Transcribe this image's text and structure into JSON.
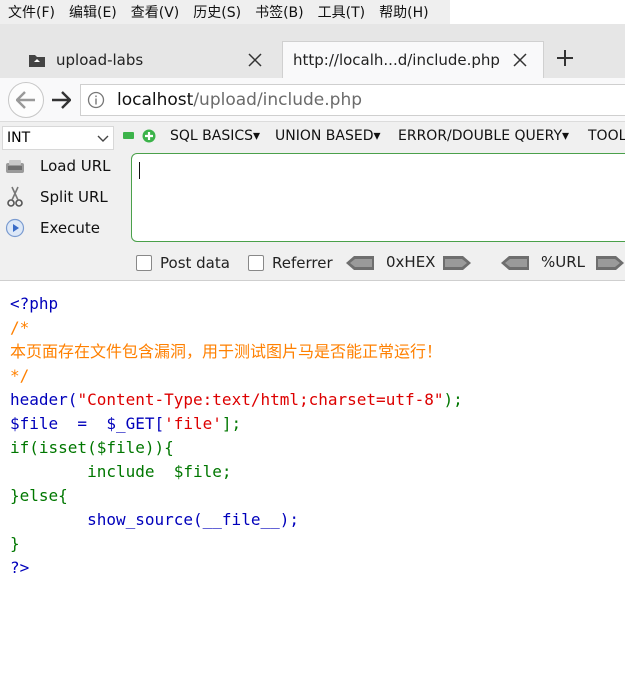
{
  "menubar": {
    "items": [
      {
        "label": "文件(F)"
      },
      {
        "label": "编辑(E)"
      },
      {
        "label": "查看(V)"
      },
      {
        "label": "历史(S)"
      },
      {
        "label": "书签(B)"
      },
      {
        "label": "工具(T)"
      },
      {
        "label": "帮助(H)"
      }
    ]
  },
  "tabs": [
    {
      "label": "upload-labs",
      "icon": "folder-icon",
      "active": false
    },
    {
      "label": "http://localh...d/include.php",
      "icon": "",
      "active": true
    }
  ],
  "navbar": {
    "url_host": "localhost",
    "url_path": "/upload/include.php"
  },
  "hackbar": {
    "select_value": "INT",
    "menus": [
      {
        "label": "SQL BASICS▾"
      },
      {
        "label": "UNION BASED▾"
      },
      {
        "label": "ERROR/DOUBLE QUERY▾"
      },
      {
        "label": "TOOL"
      }
    ],
    "actions": [
      {
        "label": "Load URL",
        "icon": "load-url-icon"
      },
      {
        "label": "Split URL",
        "icon": "scissors-icon"
      },
      {
        "label": "Execute",
        "icon": "play-icon"
      }
    ],
    "post_data_label": "Post data",
    "referrer_label": "Referrer",
    "hex_label": "0xHEX",
    "url_label": "%URL"
  },
  "code": {
    "lines": [
      "<?php",
      "/*",
      "本页面存在文件包含漏洞，用于测试图片马是否能正常运行！",
      "*/",
      "header(",
      "\"Content-Type:text/html;charset=utf-8\"",
      ");",
      "$file  =  $_GET[",
      "'file'",
      "];",
      "if(isset($file)){",
      "        include  $file;",
      "}else{",
      "        show_source(__file__);",
      "}",
      "?>"
    ]
  },
  "colors": {
    "keyword_blue": "#0000bb",
    "comment_orange": "#ff8000",
    "default_green": "#007700",
    "string_red": "#dd0000",
    "hackbar_green": "#3cb34a"
  }
}
